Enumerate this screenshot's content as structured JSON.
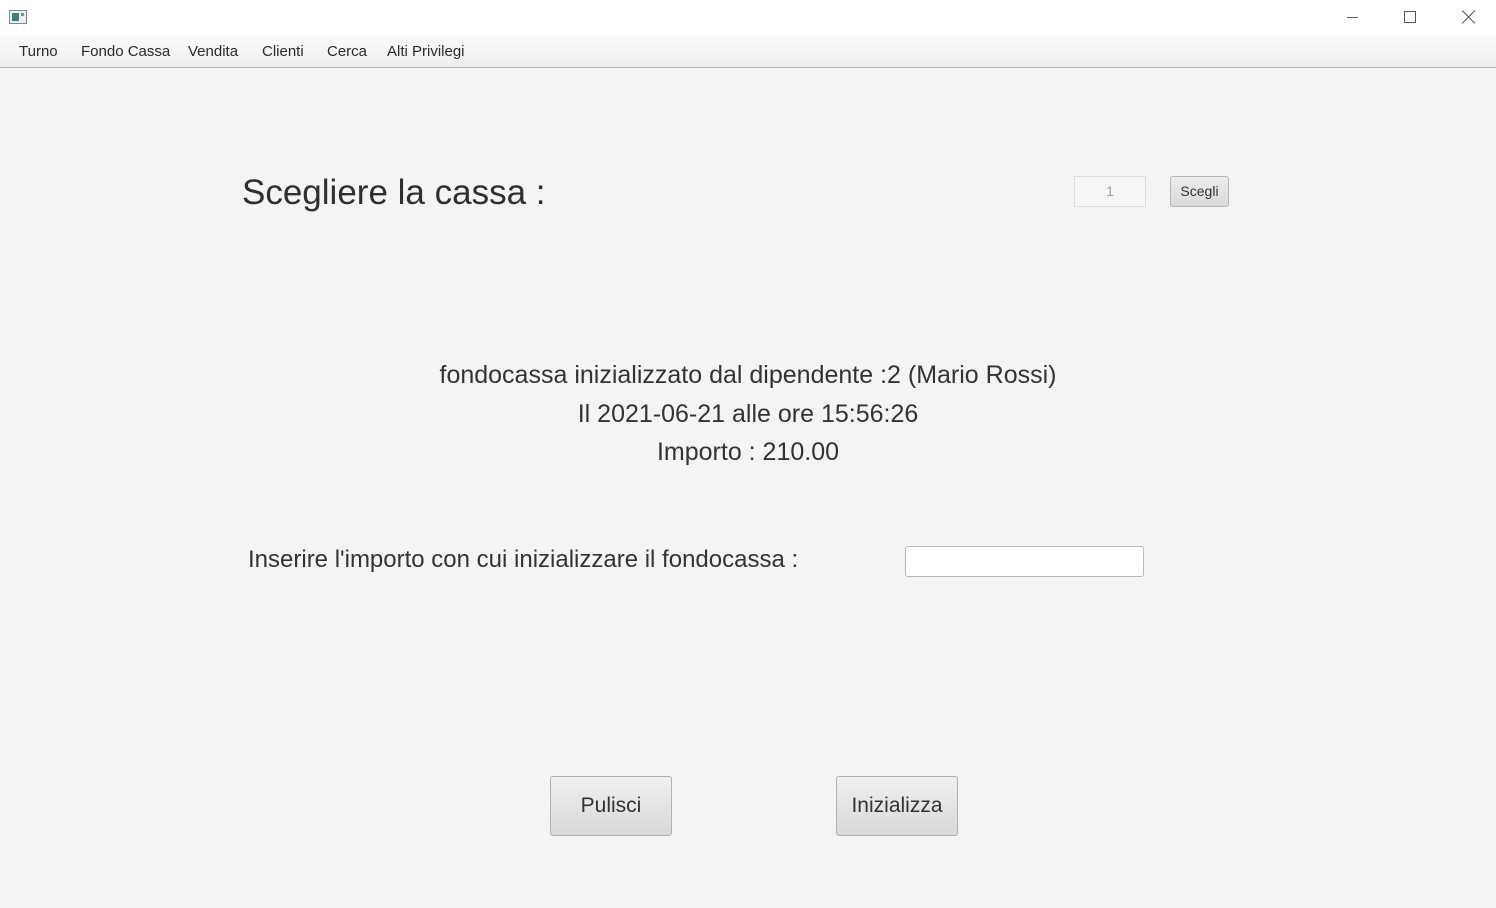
{
  "menu": {
    "items": [
      "Turno",
      "Fondo Cassa",
      "Vendita",
      "Clienti",
      "Cerca",
      "Alti Privilegi"
    ]
  },
  "cassa": {
    "heading": "Scegliere la cassa :",
    "selected_value": "1",
    "choose_label": "Scegli"
  },
  "status": {
    "line1": "fondocassa inizializzato dal dipendente :2 (Mario Rossi)",
    "line2": "Il 2021-06-21 alle ore 15:56:26",
    "line3": "Importo : 210.00"
  },
  "form": {
    "amount_label": "Inserire l'importo con cui inizializzare il fondocassa :",
    "amount_value": ""
  },
  "actions": {
    "clear_label": "Pulisci",
    "init_label": "Inizializza"
  }
}
